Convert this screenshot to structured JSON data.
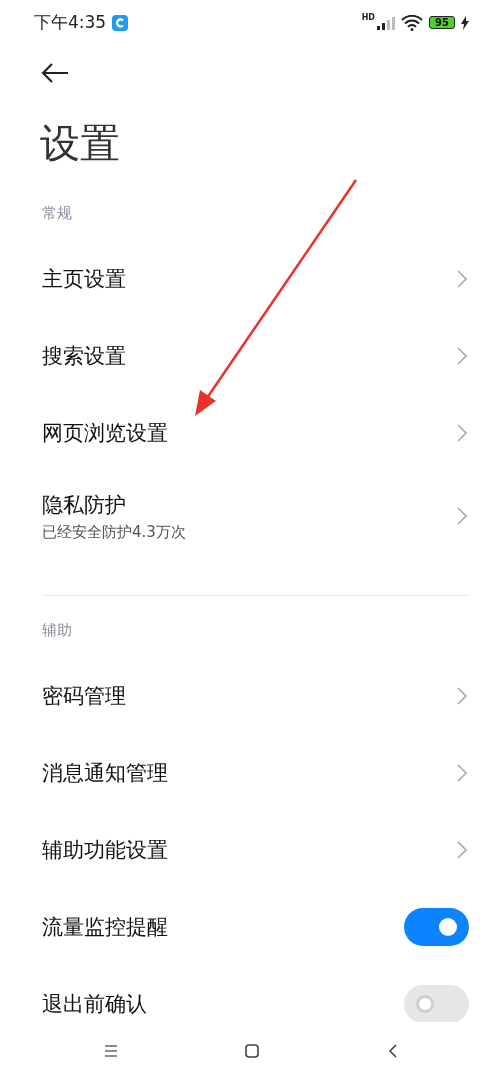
{
  "status_bar": {
    "time": "下午4:35",
    "network": "HD",
    "battery": "95"
  },
  "title": "设置",
  "sections": [
    {
      "label": "常规",
      "items": [
        {
          "kind": "link",
          "label": "主页设置"
        },
        {
          "kind": "link",
          "label": "搜索设置"
        },
        {
          "kind": "link",
          "label": "网页浏览设置"
        },
        {
          "kind": "link",
          "label": "隐私防护",
          "subtitle": "已经安全防护4.3万次"
        }
      ]
    },
    {
      "label": "辅助",
      "items": [
        {
          "kind": "link",
          "label": "密码管理"
        },
        {
          "kind": "link",
          "label": "消息通知管理"
        },
        {
          "kind": "link",
          "label": "辅助功能设置"
        },
        {
          "kind": "toggle",
          "label": "流量监控提醒",
          "on": true
        },
        {
          "kind": "toggle",
          "label": "退出前确认",
          "on": false
        }
      ]
    }
  ]
}
